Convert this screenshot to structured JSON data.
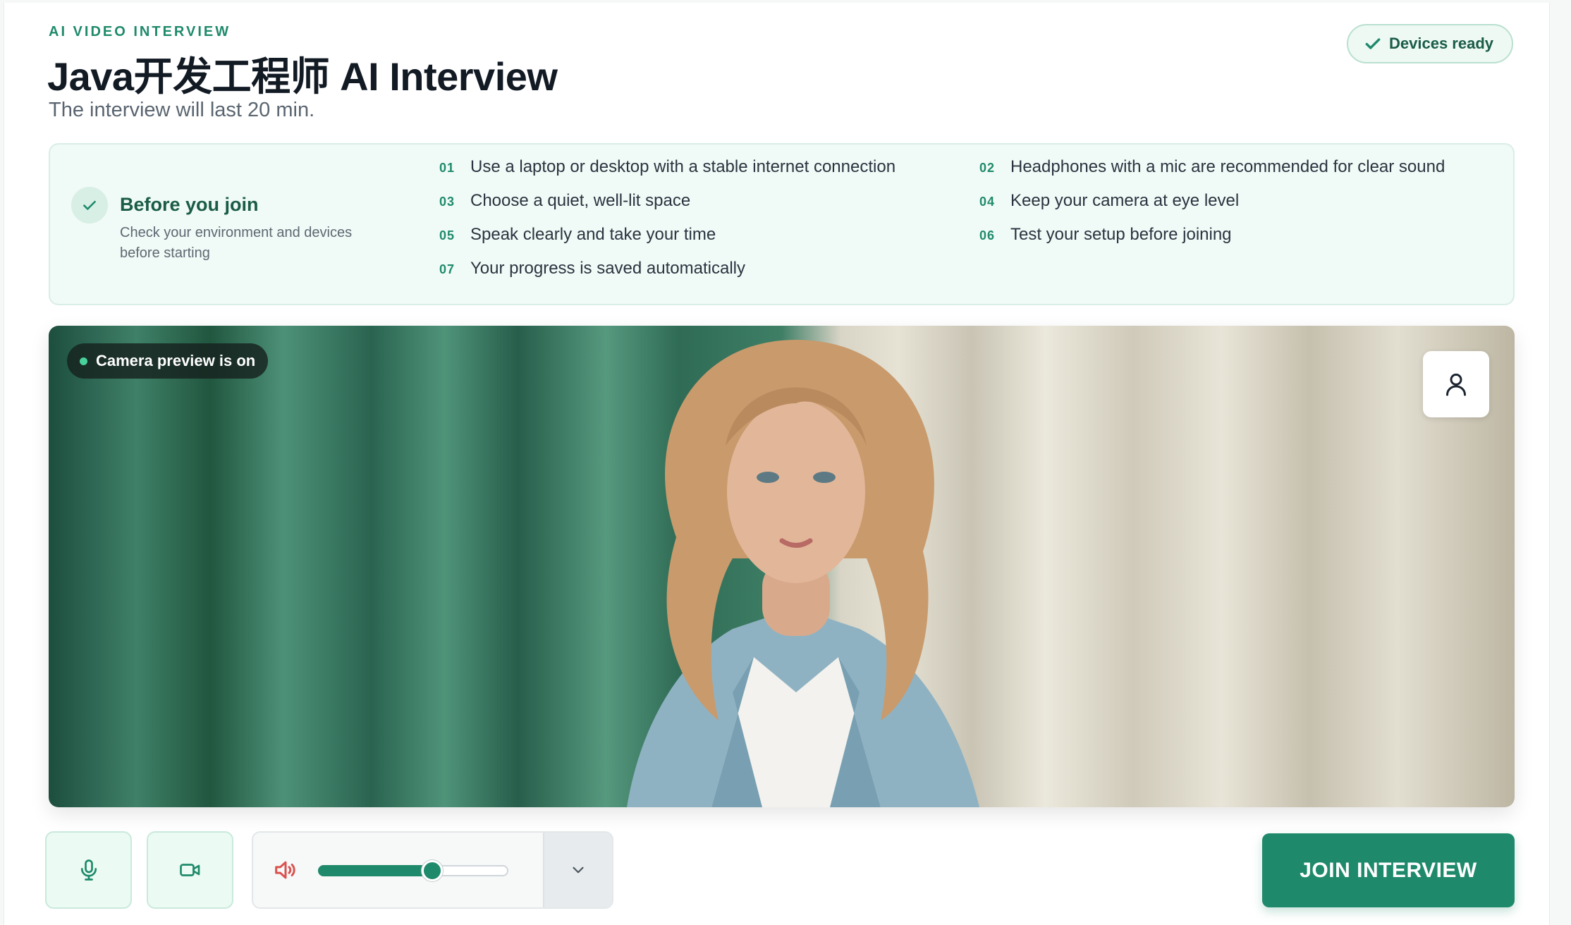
{
  "header": {
    "eyebrow": "AI VIDEO INTERVIEW",
    "title": "Java开发工程师 AI Interview",
    "subtitle": "The interview will last 20 min.",
    "badge": "Devices ready"
  },
  "tips": {
    "title": "Before you join",
    "description": "Check your environment and devices before starting",
    "items": [
      {
        "num": "01",
        "text": "Use a laptop or desktop with a stable internet connection"
      },
      {
        "num": "02",
        "text": "Headphones with a mic are recommended for clear sound"
      },
      {
        "num": "03",
        "text": "Choose a quiet, well-lit space"
      },
      {
        "num": "04",
        "text": "Keep your camera at eye level"
      },
      {
        "num": "05",
        "text": "Speak clearly and take your time"
      },
      {
        "num": "06",
        "text": "Test your setup before joining"
      },
      {
        "num": "07",
        "text": "Your progress is saved automatically"
      }
    ]
  },
  "video": {
    "status": "Camera preview is on"
  },
  "controls": {
    "volume_level": 0.6,
    "join_label": "JOIN INTERVIEW"
  },
  "colors": {
    "accent": "#1f8a6b",
    "accent_light": "#f0faf6",
    "speaker_red": "#d9534f"
  }
}
